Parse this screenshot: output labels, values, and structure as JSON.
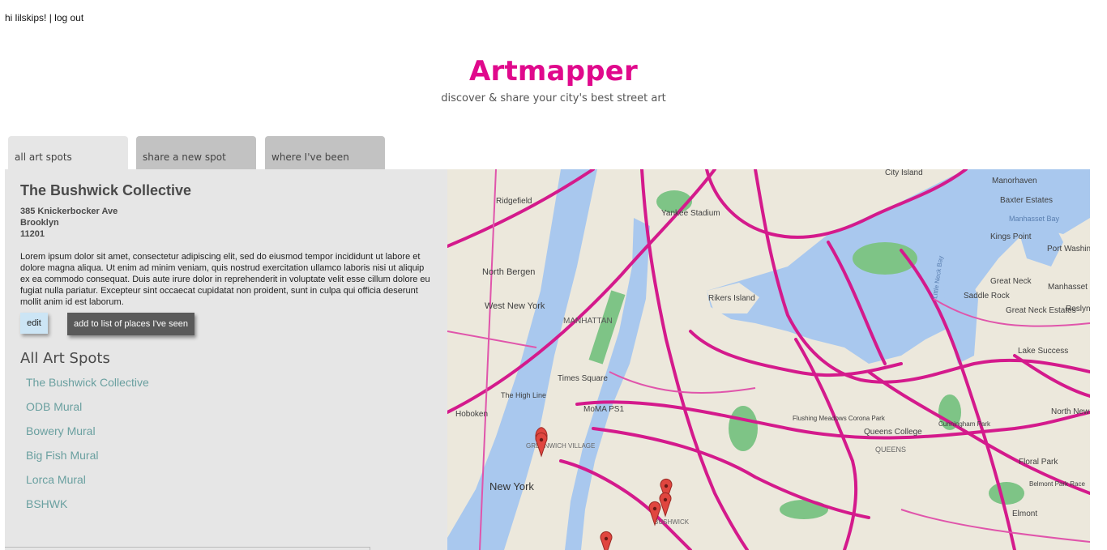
{
  "user": {
    "greeting": "hi lilskips!",
    "separator": " | ",
    "logout": "log out"
  },
  "header": {
    "title": "Artmapper",
    "tagline": "discover & share your city's best street art"
  },
  "tabs": [
    {
      "label": "all art spots",
      "active": true
    },
    {
      "label": "share a new spot",
      "active": false
    },
    {
      "label": "where I've been",
      "active": false
    }
  ],
  "detail": {
    "name": "The Bushwick Collective",
    "address": [
      "385 Knickerbocker Ave",
      "Brooklyn",
      "11201"
    ],
    "description": "Lorem ipsum dolor sit amet, consectetur adipiscing elit, sed do eiusmod tempor incididunt ut labore et dolore magna aliqua. Ut enim ad minim veniam, quis nostrud exercitation ullamco laboris nisi ut aliquip ex ea commodo consequat. Duis aute irure dolor in reprehenderit in voluptate velit esse cillum dolore eu fugiat nulla pariatur. Excepteur sint occaecat cupidatat non proident, sunt in culpa qui officia deserunt mollit anim id est laborum.",
    "edit_label": "edit",
    "add_label": "add to list of places I've seen"
  },
  "list": {
    "heading": "All Art Spots",
    "items": [
      "The Bushwick Collective",
      "ODB Mural",
      "Bowery Mural",
      "Big Fish Mural",
      "Lorca Mural",
      "BSHWK"
    ]
  },
  "map": {
    "labels": {
      "city_island": "City Island",
      "manorhaven": "Manorhaven",
      "baxter_estates": "Baxter Estates",
      "manhasset_bay": "Manhasset Bay",
      "kings_point": "Kings Point",
      "port_washington": "Port Washington",
      "ridgefield": "Ridgefield",
      "north_bergen": "North Bergen",
      "west_new_york": "West New York",
      "hoboken": "Hoboken",
      "the_high_line": "The High Line",
      "manhattan": "MANHATTAN",
      "times_square": "Times Square",
      "moma_ps1": "MoMA PS1",
      "yankee_stadium": "Yankee Stadium",
      "rikers_island": "Rikers Island",
      "great_neck": "Great Neck",
      "saddle_rock": "Saddle Rock",
      "manhasset": "Manhasset",
      "little_neck_bay": "Little Neck Bay",
      "lake_success": "Lake Success",
      "flushing_meadows": "Flushing Meadows Corona Park",
      "queens_college": "Queens College",
      "queens": "QUEENS",
      "north_new_hyde_park": "North New Hyde Park",
      "floral_park": "Floral Park",
      "belmont_park": "Belmont Park Race",
      "elmont": "Elmont",
      "new_york": "New York",
      "cunningham_park": "Cunningham Park",
      "bushwick": "BUSHWICK",
      "greenwich_village": "GREENWICH VILLAGE",
      "great_neck_estates": "Great Neck Estates",
      "roslyn": "Roslyn"
    },
    "colors": {
      "water": "#a9c8ee",
      "land": "#ece8dc",
      "park": "#7ec486",
      "highway": "#d41a8c",
      "pin": "#e0463f"
    },
    "pin_count": 5
  }
}
